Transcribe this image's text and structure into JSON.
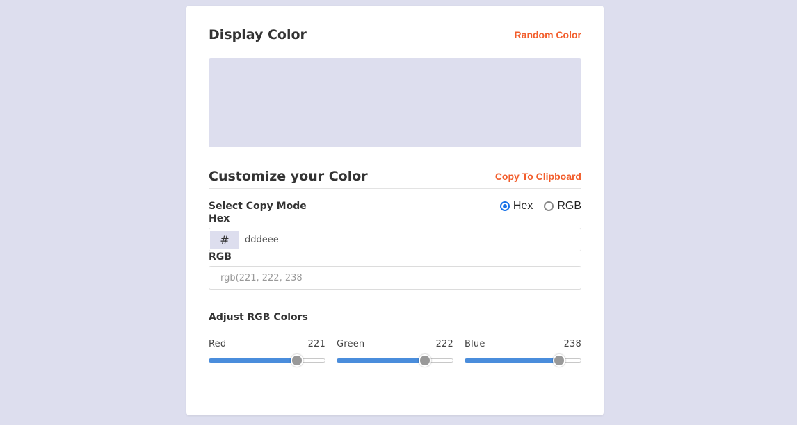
{
  "display": {
    "title": "Display Color",
    "random_label": "Random Color",
    "preview_color": "#dddeee"
  },
  "customize": {
    "title": "Customize your Color",
    "copy_label": "Copy To Clipboard",
    "copy_mode_label": "Select Copy Mode",
    "modes": [
      {
        "label": "Hex",
        "checked": true
      },
      {
        "label": "RGB",
        "checked": false
      }
    ],
    "hex_label": "Hex",
    "hex_prefix": "#",
    "hex_value": "dddeee",
    "rgb_label": "RGB",
    "rgb_placeholder": "rgb(221, 222, 238"
  },
  "adjust": {
    "title": "Adjust RGB Colors",
    "max": 255,
    "sliders": [
      {
        "label": "Red",
        "value": 221
      },
      {
        "label": "Green",
        "value": 222
      },
      {
        "label": "Blue",
        "value": 238
      }
    ]
  },
  "colors": {
    "accent": "#f25d2b",
    "slider_fill": "#4a8ddc",
    "radio_checked": "#1a73e8",
    "background": "#dddeee"
  }
}
